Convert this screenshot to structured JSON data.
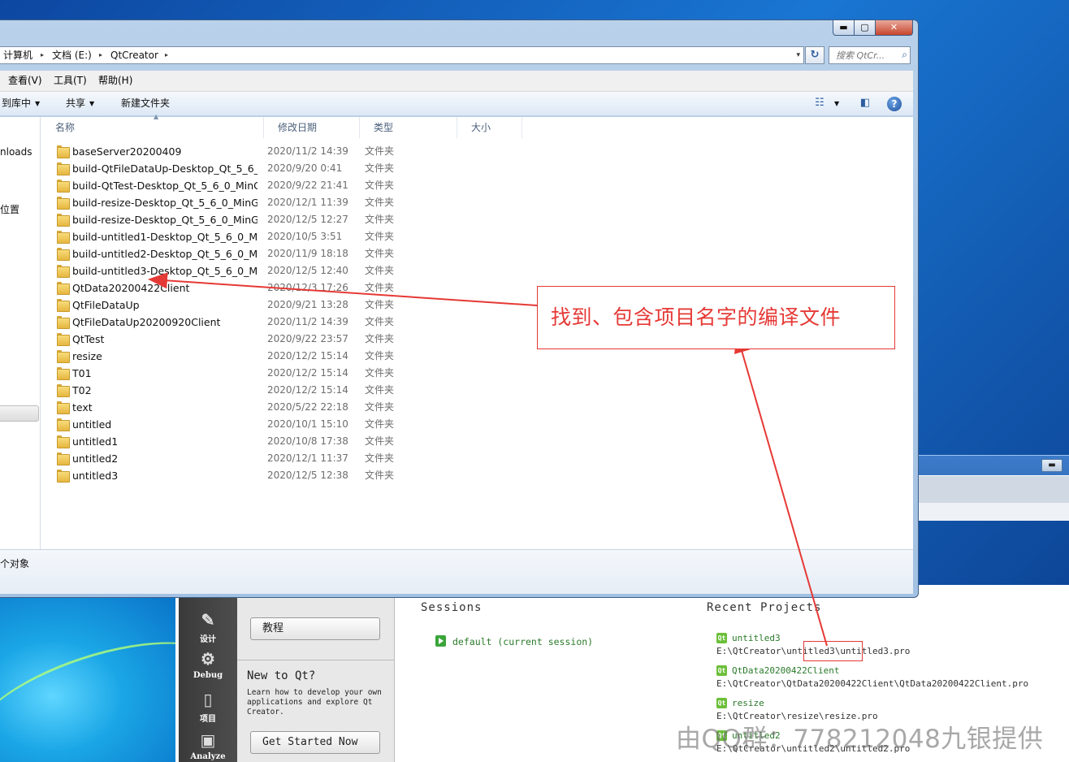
{
  "explorer": {
    "caption": {
      "min": "▬",
      "max": "▢",
      "close": "✕"
    },
    "address": {
      "crumbs": [
        "计算机",
        "文档 (E:)",
        "QtCreator"
      ],
      "separator": "▸",
      "dropdown": "▾",
      "refresh": "↻"
    },
    "search": {
      "placeholder": "搜索 QtCr...",
      "icon": "search-icon"
    },
    "menu": [
      "查看(V)",
      "工具(T)",
      "帮助(H)"
    ],
    "toolbar": {
      "include_library": "到库中",
      "share": "共享",
      "new_folder": "新建文件夹",
      "view_icon": "view-icon",
      "preview_icon": "preview-pane-icon",
      "help": "?"
    },
    "nav": {
      "item1": "nloads",
      "item2": "位置"
    },
    "columns": {
      "name": "名称",
      "date": "修改日期",
      "type": "类型",
      "size": "大小"
    },
    "files": [
      {
        "name": "baseServer20200409",
        "date": "2020/11/2 14:39",
        "type": "文件夹"
      },
      {
        "name": "build-QtFileDataUp-Desktop_Qt_5_6_...",
        "date": "2020/9/20 0:41",
        "type": "文件夹"
      },
      {
        "name": "build-QtTest-Desktop_Qt_5_6_0_MinG...",
        "date": "2020/9/22 21:41",
        "type": "文件夹"
      },
      {
        "name": "build-resize-Desktop_Qt_5_6_0_MinG...",
        "date": "2020/12/1 11:39",
        "type": "文件夹"
      },
      {
        "name": "build-resize-Desktop_Qt_5_6_0_MinG...",
        "date": "2020/12/5 12:27",
        "type": "文件夹"
      },
      {
        "name": "build-untitled1-Desktop_Qt_5_6_0_Mi...",
        "date": "2020/10/5 3:51",
        "type": "文件夹"
      },
      {
        "name": "build-untitled2-Desktop_Qt_5_6_0_Mi...",
        "date": "2020/11/9 18:18",
        "type": "文件夹"
      },
      {
        "name": "build-untitled3-Desktop_Qt_5_6_0_Mi...",
        "date": "2020/12/5 12:40",
        "type": "文件夹"
      },
      {
        "name": "QtData20200422Client",
        "date": "2020/12/3 17:26",
        "type": "文件夹"
      },
      {
        "name": "QtFileDataUp",
        "date": "2020/9/21 13:28",
        "type": "文件夹"
      },
      {
        "name": "QtFileDataUp20200920Client",
        "date": "2020/11/2 14:39",
        "type": "文件夹"
      },
      {
        "name": "QtTest",
        "date": "2020/9/22 23:57",
        "type": "文件夹"
      },
      {
        "name": "resize",
        "date": "2020/12/2 15:14",
        "type": "文件夹"
      },
      {
        "name": "T01",
        "date": "2020/12/2 15:14",
        "type": "文件夹"
      },
      {
        "name": "T02",
        "date": "2020/12/2 15:14",
        "type": "文件夹"
      },
      {
        "name": "text",
        "date": "2020/5/22 22:18",
        "type": "文件夹"
      },
      {
        "name": "untitled",
        "date": "2020/10/1 15:10",
        "type": "文件夹"
      },
      {
        "name": "untitled1",
        "date": "2020/10/8 17:38",
        "type": "文件夹"
      },
      {
        "name": "untitled2",
        "date": "2020/12/1 11:37",
        "type": "文件夹"
      },
      {
        "name": "untitled3",
        "date": "2020/12/5 12:38",
        "type": "文件夹"
      }
    ],
    "status": "个对象"
  },
  "bg_window": {
    "min": "▬"
  },
  "qt": {
    "modes": [
      {
        "label": "设计",
        "icon": "design-icon"
      },
      {
        "label": "Debug",
        "icon": "debug-icon"
      },
      {
        "label": "项目",
        "icon": "projects-icon"
      },
      {
        "label": "Analyze",
        "icon": "analyze-icon"
      }
    ],
    "tutorial_button": "教程",
    "new_to_qt": "New to Qt?",
    "new_desc": "Learn how to develop your own applications and explore Qt Creator.",
    "get_started": "Get Started Now",
    "sessions_title": "Sessions",
    "session": "default (current session)",
    "recent_title": "Recent Projects",
    "projects": [
      {
        "name": "untitled3",
        "path": "E:\\QtCreator\\untitled3\\untitled3.pro"
      },
      {
        "name": "QtData20200422Client",
        "path": "E:\\QtCreator\\QtData20200422Client\\QtData20200422Client.pro"
      },
      {
        "name": "resize",
        "path": "E:\\QtCreator\\resize\\resize.pro"
      },
      {
        "name": "untitled2",
        "path": "E:\\QtCreator\\untitled2\\untitled2.pro"
      }
    ]
  },
  "annotation": {
    "text": "找到、包含项目名字的编译文件",
    "color": "#e53935"
  },
  "watermark": "由QQ群：778212048九银提供"
}
